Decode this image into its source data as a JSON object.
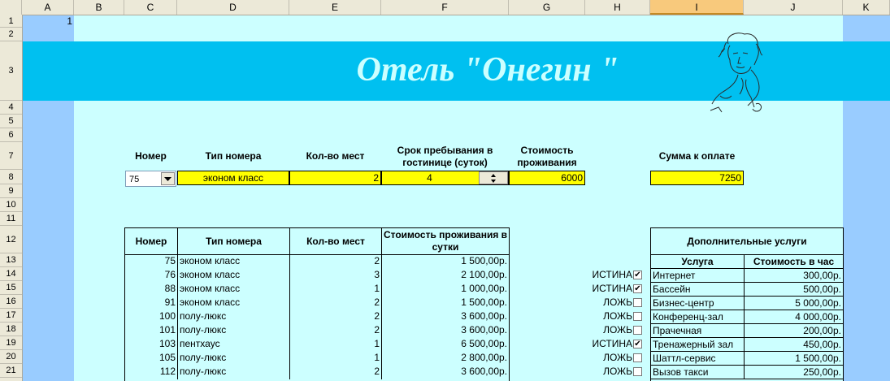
{
  "columns": [
    "A",
    "B",
    "C",
    "D",
    "E",
    "F",
    "G",
    "H",
    "I",
    "J",
    "K"
  ],
  "selected_column": "I",
  "rows": [
    "1",
    "2",
    "3",
    "4",
    "5",
    "6",
    "7",
    "8",
    "9",
    "10",
    "11",
    "12",
    "13",
    "14",
    "15",
    "16",
    "17",
    "18",
    "19",
    "20",
    "21"
  ],
  "cell_a1": "1",
  "banner_title": "Отель \"Онегин \"",
  "colors": {
    "banner": "#00c0f0",
    "sheet_bg": "#ccffff",
    "left_band": "#99ccff",
    "input_fill": "#ffff00",
    "header_bg": "#ece9d8"
  },
  "form": {
    "headers": {
      "number": "Номер",
      "room_type": "Тип номера",
      "seats": "Кол-во мест",
      "stay": "Срок пребывания в гостинице (суток)",
      "cost": "Стоимость проживания",
      "total": "Сумма к оплате"
    },
    "values": {
      "number": "75",
      "room_type": "эконом класс",
      "seats": "2",
      "stay": "4",
      "cost": "6000",
      "total": "7250"
    }
  },
  "rooms_table": {
    "headers": [
      "Номер",
      "Тип номера",
      "Кол-во мест",
      "Стоимость проживания в сутки"
    ],
    "rows": [
      [
        "75",
        "эконом класс",
        "2",
        "1 500,00р."
      ],
      [
        "76",
        "эконом класс",
        "3",
        "2 100,00р."
      ],
      [
        "88",
        "эконом класс",
        "1",
        "1 000,00р."
      ],
      [
        "91",
        "эконом класс",
        "2",
        "1 500,00р."
      ],
      [
        "100",
        "полу-люкс",
        "2",
        "3 600,00р."
      ],
      [
        "101",
        "полу-люкс",
        "2",
        "3 600,00р."
      ],
      [
        "103",
        "пентхаус",
        "1",
        "6 500,00р."
      ],
      [
        "105",
        "полу-люкс",
        "1",
        "2 800,00р."
      ],
      [
        "112",
        "полу-люкс",
        "2",
        "3 600,00р."
      ]
    ]
  },
  "services": {
    "title": "Дополнительные услуги",
    "headers": [
      "Услуга",
      "Стоимость в час"
    ],
    "rows": [
      {
        "flag": "ИСТИНА",
        "checked": true,
        "name": "Интернет",
        "price": "300,00р."
      },
      {
        "flag": "ИСТИНА",
        "checked": true,
        "name": "Бассейн",
        "price": "500,00р."
      },
      {
        "flag": "ЛОЖЬ",
        "checked": false,
        "name": "Бизнес-центр",
        "price": "5 000,00р."
      },
      {
        "flag": "ЛОЖЬ",
        "checked": false,
        "name": "Конференц-зал",
        "price": "4 000,00р."
      },
      {
        "flag": "ЛОЖЬ",
        "checked": false,
        "name": "Прачечная",
        "price": "200,00р."
      },
      {
        "flag": "ИСТИНА",
        "checked": true,
        "name": "Тренажерный зал",
        "price": "450,00р."
      },
      {
        "flag": "ЛОЖЬ",
        "checked": false,
        "name": "Шаттл-сервис",
        "price": "1 500,00р."
      },
      {
        "flag": "ЛОЖЬ",
        "checked": false,
        "name": "Вызов такси",
        "price": "250,00р."
      }
    ]
  }
}
